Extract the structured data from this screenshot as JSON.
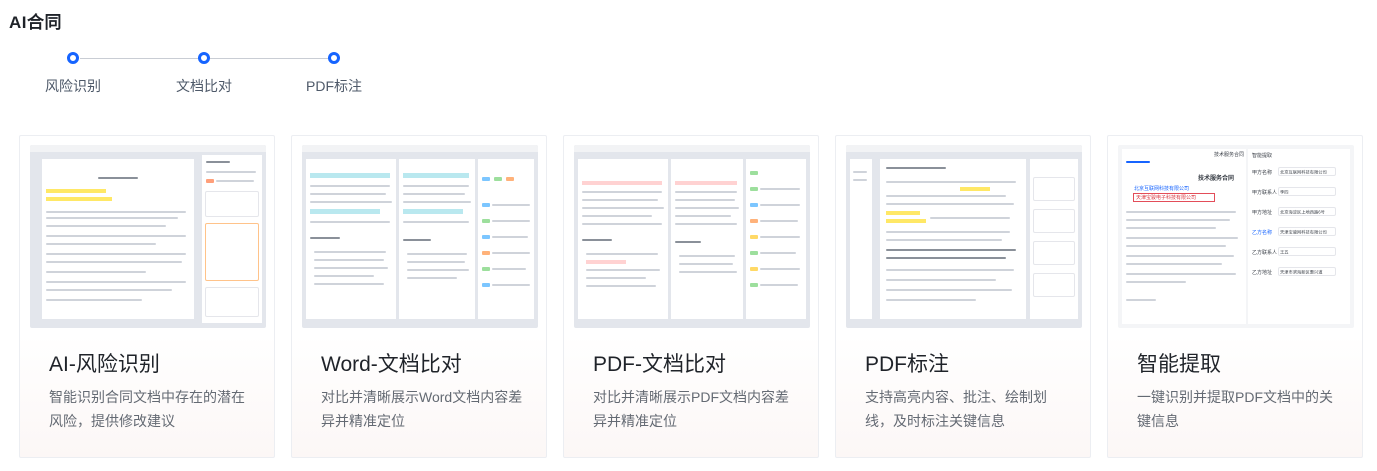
{
  "page": {
    "title": "AI合同"
  },
  "stepper": {
    "steps": [
      {
        "label": "风险识别"
      },
      {
        "label": "文档比对"
      },
      {
        "label": "PDF标注"
      }
    ],
    "accent_color": "#1664ff"
  },
  "cards": [
    {
      "title": "AI-风险识别",
      "desc": "智能识别合同文档中存在的潜在风险，提供修改建议"
    },
    {
      "title": "Word-文档比对",
      "desc": "对比并清晰展示Word文档内容差异并精准定位"
    },
    {
      "title": "PDF-文档比对",
      "desc": "对比并清晰展示PDF文档内容差异并精准定位"
    },
    {
      "title": "PDF标注",
      "desc": "支持高亮内容、批注、绘制划线，及时标注关键信息"
    },
    {
      "title": "智能提取",
      "desc": "一键识别并提取PDF文档中的关键信息"
    }
  ],
  "thumb_extract": {
    "header": "技术服务合同",
    "panel_title": "智能提取",
    "fields": [
      {
        "label": "甲方名称",
        "value": "北京互联网科技有限公司"
      },
      {
        "label": "甲方联系人",
        "value": "李四"
      },
      {
        "label": "甲方地址",
        "value": "北京海淀区上地西路6号"
      },
      {
        "label": "乙方名称",
        "value": "天津宝骏网科技有限公司"
      },
      {
        "label": "乙方联系人",
        "value": "王五"
      },
      {
        "label": "乙方地址",
        "value": "天津市滨海新区惠兴道"
      }
    ],
    "party_a": "北京互联网科技有限公司",
    "party_b": "天津宝骏电子科技有限公司"
  }
}
